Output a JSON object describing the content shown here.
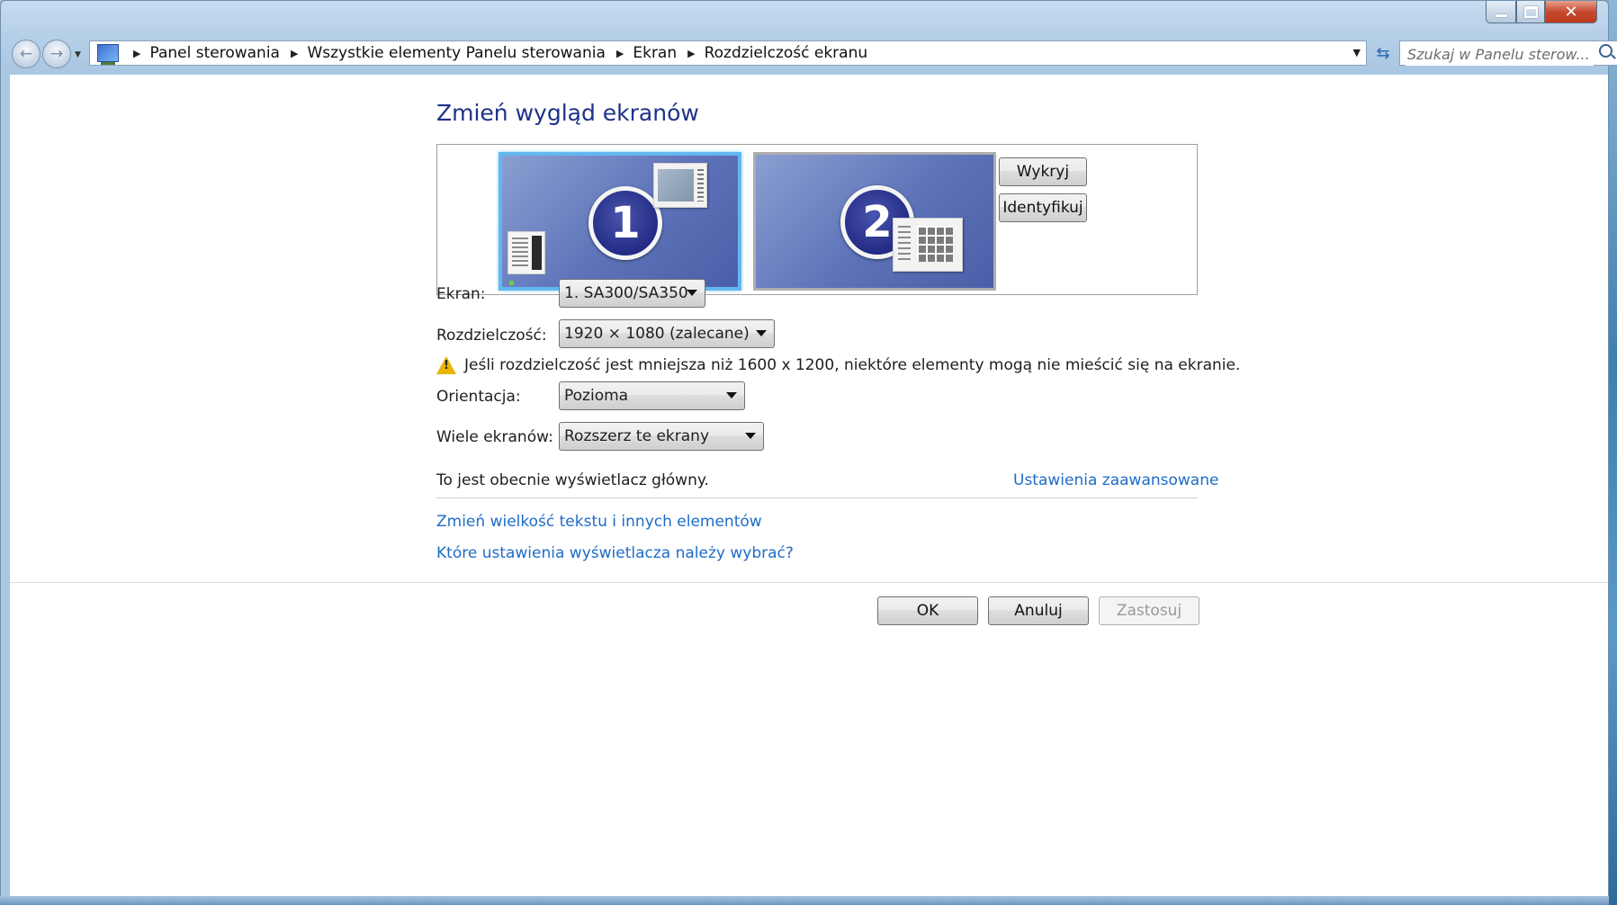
{
  "window": {
    "minimize_icon": "minimize-icon",
    "maximize_icon": "maximize-icon",
    "close_icon": "close-icon"
  },
  "nav": {
    "back_icon": "back-arrow-icon",
    "forward_icon": "forward-arrow-icon",
    "breadcrumbs": [
      "Panel sterowania",
      "Wszystkie elementy Panelu sterowania",
      "Ekran",
      "Rozdzielczość ekranu"
    ],
    "search_placeholder": "Szukaj w Panelu sterow..."
  },
  "page": {
    "title": "Zmień wygląd ekranów",
    "monitors": [
      {
        "number": "1",
        "selected": true
      },
      {
        "number": "2",
        "selected": false
      }
    ],
    "detect_button": "Wykryj",
    "identify_button": "Identyfikuj",
    "display_label": "Ekran:",
    "display_value": "1. SA300/SA350",
    "resolution_label": "Rozdzielczość:",
    "resolution_value": "1920 × 1080 (zalecane)",
    "warning_text": "Jeśli rozdzielczość jest mniejsza niż 1600 x 1200, niektóre elementy mogą nie mieścić się na ekranie.",
    "orientation_label": "Orientacja:",
    "orientation_value": "Pozioma",
    "multi_label": "Wiele ekranów:",
    "multi_value": "Rozszerz te ekrany",
    "main_display_text": "To jest obecnie wyświetlacz główny.",
    "advanced_link": "Ustawienia zaawansowane",
    "text_size_link": "Zmień wielkość tekstu i innych elementów",
    "which_settings_link": "Które ustawienia wyświetlacza należy wybrać?"
  },
  "footer": {
    "ok": "OK",
    "cancel": "Anuluj",
    "apply": "Zastosuj"
  },
  "colors": {
    "title": "#1e3287",
    "link": "#1e6cc8",
    "selected_monitor_border": "#63b7f0"
  }
}
